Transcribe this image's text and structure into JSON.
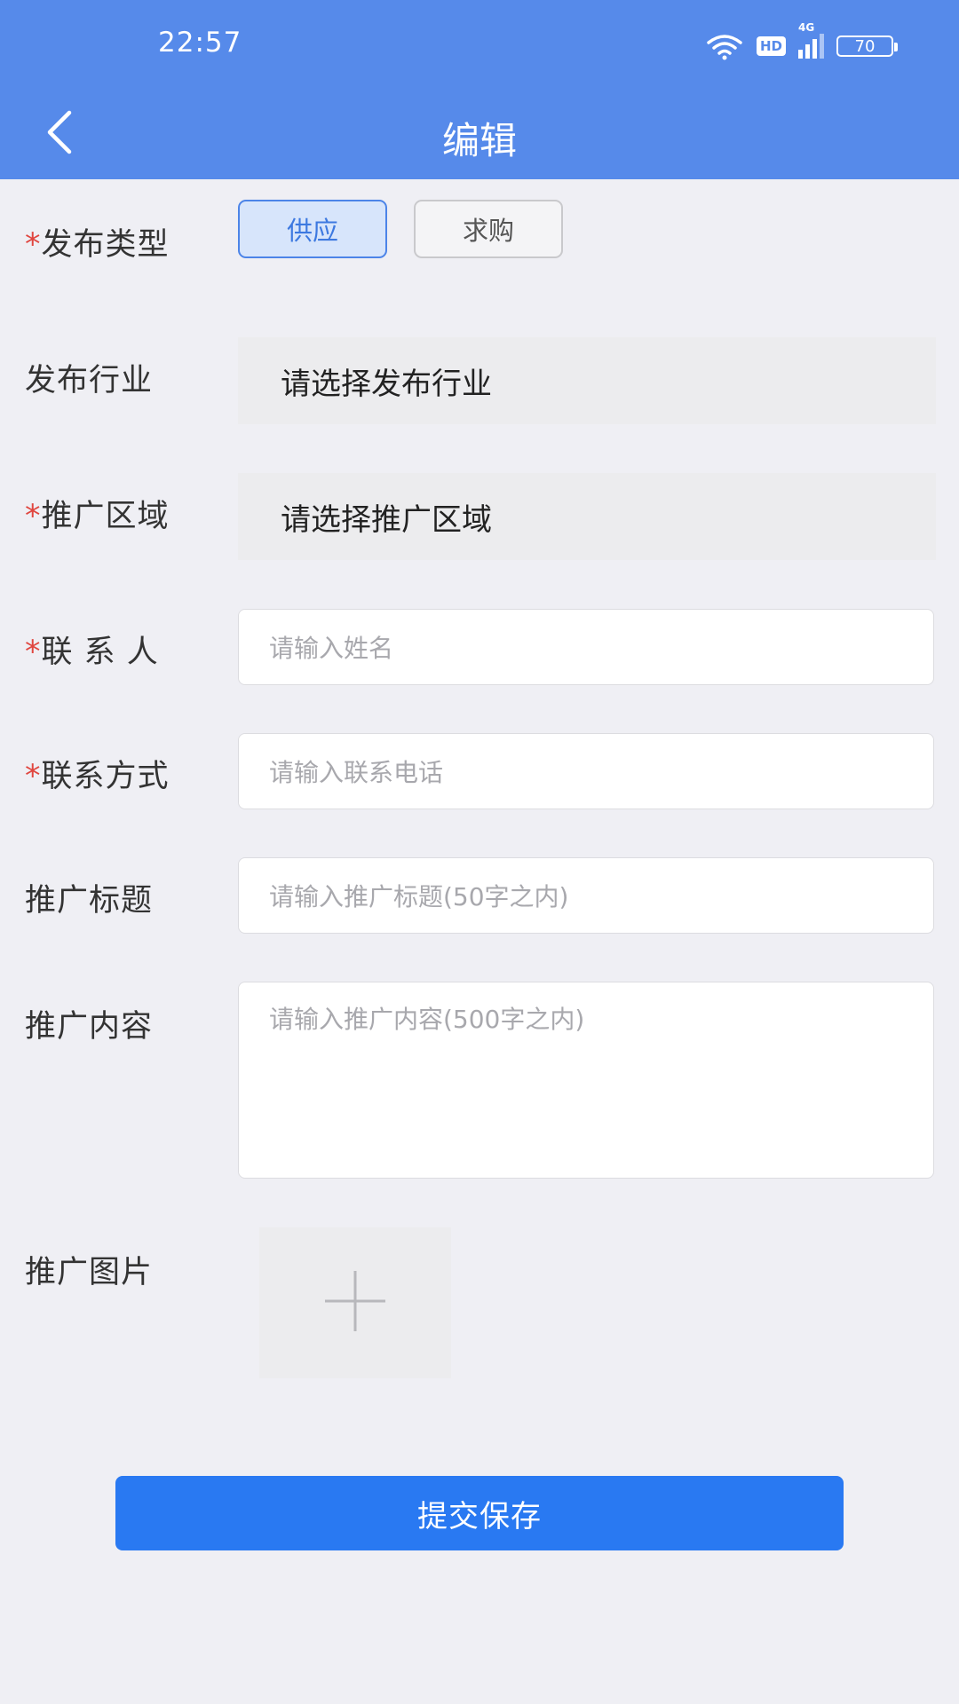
{
  "status_bar": {
    "time": "22:57",
    "network_label": "HD",
    "signal_label": "4G",
    "battery_level": "70"
  },
  "nav": {
    "title": "编辑"
  },
  "form": {
    "required_mark": "*",
    "publish_type": {
      "label": "发布类型",
      "options": [
        "供应",
        "求购"
      ],
      "selected": "供应"
    },
    "industry": {
      "label": "发布行业",
      "placeholder": "请选择发布行业"
    },
    "region": {
      "label": "推广区域",
      "placeholder": "请选择推广区域"
    },
    "contact_person": {
      "label": "联 系 人",
      "placeholder": "请输入姓名"
    },
    "contact_method": {
      "label": "联系方式",
      "placeholder": "请输入联系电话"
    },
    "promo_title": {
      "label": "推广标题",
      "placeholder": "请输入推广标题(50字之内)"
    },
    "promo_content": {
      "label": "推广内容",
      "placeholder": "请输入推广内容(500字之内)"
    },
    "promo_image": {
      "label": "推广图片"
    }
  },
  "submit": {
    "label": "提交保存"
  },
  "colors": {
    "header": "#568aea",
    "accent": "#2979f2",
    "required": "#e0463f",
    "background": "#efeff4"
  }
}
